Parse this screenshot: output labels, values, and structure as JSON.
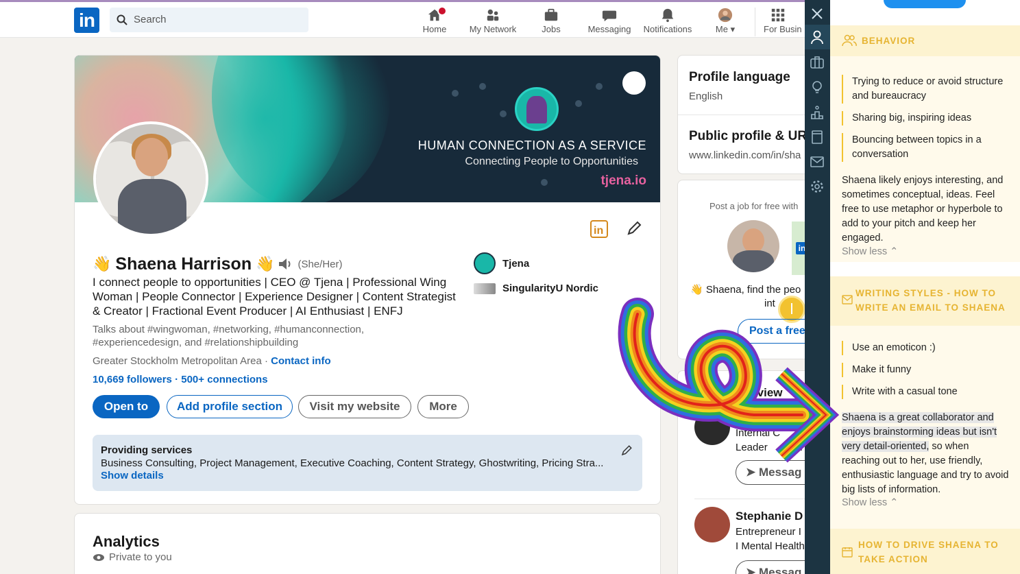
{
  "header": {
    "logo": "in",
    "search_placeholder": "Search",
    "nav": [
      {
        "label": "Home",
        "icon": "home-icon"
      },
      {
        "label": "My Network",
        "icon": "network-icon"
      },
      {
        "label": "Jobs",
        "icon": "briefcase-icon"
      },
      {
        "label": "Messaging",
        "icon": "messaging-icon"
      },
      {
        "label": "Notifications",
        "icon": "bell-icon"
      },
      {
        "label": "Me",
        "icon": "avatar-icon"
      },
      {
        "label": "For Busin",
        "icon": "grid-icon"
      }
    ]
  },
  "profile": {
    "banner_title": "HUMAN CONNECTION AS A SERVICE",
    "banner_subtitle": "Connecting People to Opportunities",
    "banner_url": "tjena.io",
    "name": "Shaena Harrison",
    "name_prefix_emoji": "👋",
    "name_suffix_emoji": "👋",
    "pronouns": "(She/Her)",
    "headline": "I connect people to opportunities | CEO @ Tjena | Professional Wing Woman | People Connector | Experience Designer | Content Strategist & Creator | Fractional Event Producer | AI Enthusiast | ENFJ",
    "talks_about": "Talks about #wingwoman, #networking, #humanconnection, #experiencedesign, and #relationshipbuilding",
    "location": "Greater Stockholm Metropolitan Area ·",
    "contact_info": "Contact info",
    "followers": "10,669 followers",
    "connections": "· 500+ connections",
    "buttons": {
      "open_to": "Open to",
      "add_section": "Add profile section",
      "visit_website": "Visit my website",
      "more": "More"
    },
    "companies": [
      "Tjena",
      "SingularityU Nordic"
    ],
    "services_title": "Providing services",
    "services_list": "Business Consulting, Project Management, Executive Coaching, Content Strategy, Ghostwriting, Pricing Stra...",
    "services_link": "Show details"
  },
  "analytics": {
    "title": "Analytics",
    "subtitle": "Private to you"
  },
  "sidebar": {
    "profile_language_title": "Profile language",
    "profile_language_value": "English",
    "public_profile_title": "Public profile & URL",
    "public_profile_value": "www.linkedin.com/in/sha",
    "post_job_text": "Post a job for free with",
    "find_text": "Shaena, find the peo",
    "find_text2": "int",
    "post_free_button": "Post a free",
    "also_viewed_title": "le also view",
    "person1_title": "Internal C",
    "person1_title2": "Leader",
    "person1_title_b": "pl",
    "message_button": "Messag",
    "person2_name": "Stephanie D",
    "person2_title": "Entrepreneur I",
    "person2_title2": "I Mental Health",
    "message_button2": "Messag"
  },
  "extension": {
    "behavior_title": "BEHAVIOR",
    "behavior_bullets": [
      "Trying to reduce or avoid structure and bureaucracy",
      "Sharing big, inspiring ideas",
      "Bouncing between topics in a conversation"
    ],
    "behavior_para": "Shaena likely enjoys interesting, and sometimes conceptual, ideas. Feel free to use metaphor or hyperbole to add to your pitch and keep her engaged.",
    "show_less": "Show less",
    "writing_title": "WRITING STYLES - HOW TO WRITE AN EMAIL TO SHAENA",
    "writing_bullets": [
      "Use an emoticon :)",
      "Make it funny",
      "Write with a casual tone"
    ],
    "writing_para_highlight": "Shaena is a great collaborator and enjoys brainstorming ideas but isn't very detail-oriented,",
    "writing_para_rest": " so when reaching out to her, use friendly, enthusiastic language and try to avoid big lists of information.",
    "show_less2": "Show less",
    "action_title": "HOW TO DRIVE SHAENA TO TAKE ACTION"
  },
  "colors": {
    "linkedin_blue": "#0a66c2",
    "panel_yellow": "#e6b432",
    "ext_bar": "#1c3442"
  }
}
